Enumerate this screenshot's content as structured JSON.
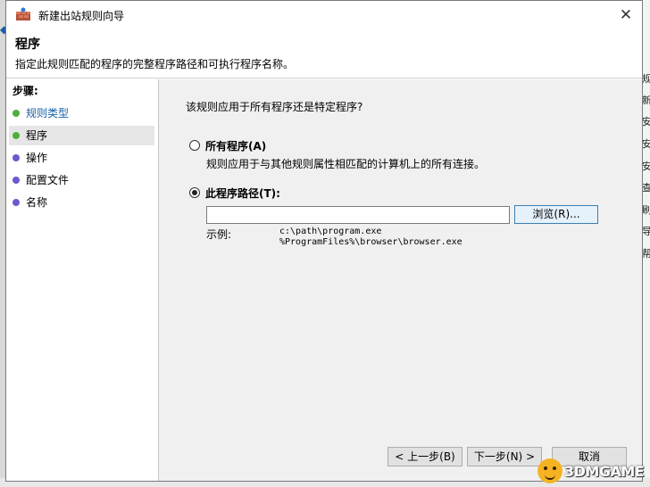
{
  "window": {
    "title": "新建出站规则向导",
    "close_glyph": "✕"
  },
  "header": {
    "title": "程序",
    "description": "指定此规则匹配的程序的完整程序路径和可执行程序名称。"
  },
  "steps": {
    "title": "步骤:",
    "items": [
      {
        "label": "规则类型",
        "dot_color": "#4caf3a",
        "state": "done"
      },
      {
        "label": "程序",
        "dot_color": "#4caf3a",
        "state": "current"
      },
      {
        "label": "操作",
        "dot_color": "#6a5acd",
        "state": "pending"
      },
      {
        "label": "配置文件",
        "dot_color": "#6a5acd",
        "state": "pending"
      },
      {
        "label": "名称",
        "dot_color": "#6a5acd",
        "state": "pending"
      }
    ]
  },
  "content": {
    "question": "该规则应用于所有程序还是特定程序?",
    "option_all": {
      "label": "所有程序(A)",
      "description": "规则应用于与其他规则属性相匹配的计算机上的所有连接。",
      "selected": false
    },
    "option_path": {
      "label": "此程序路径(T):",
      "selected": true
    },
    "path_input": {
      "value": "",
      "placeholder": ""
    },
    "browse_label": "浏览(R)...",
    "example_label": "示例:",
    "example_line1": "c:\\path\\program.exe",
    "example_line2": "%ProgramFiles%\\browser\\browser.exe"
  },
  "buttons": {
    "back": "< 上一步(B)",
    "next": "下一步(N) >",
    "cancel": "取消"
  },
  "background": {
    "right_fragments": [
      "规",
      "新",
      "安",
      "安",
      "安",
      "查",
      "刷",
      "导",
      "帮"
    ],
    "watermark_text": "3DMGAME"
  }
}
